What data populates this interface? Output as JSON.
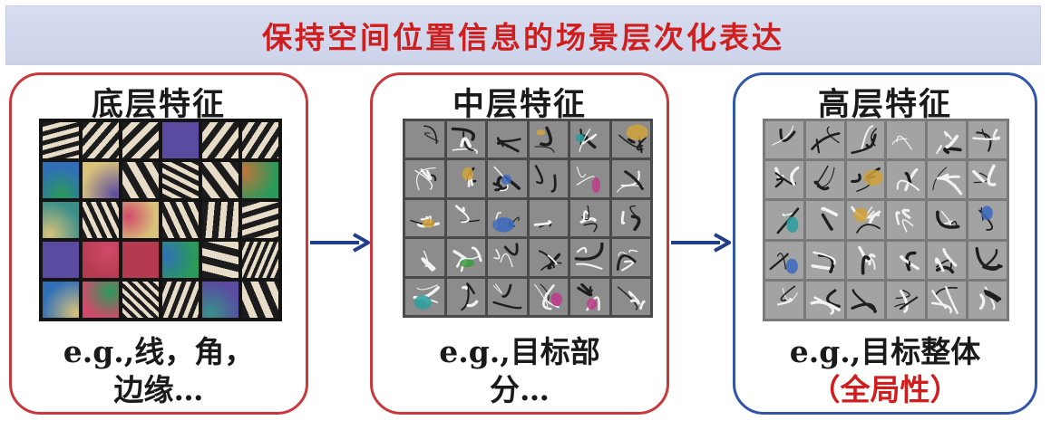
{
  "banner": {
    "title": "保持空间位置信息的场景层次化表达"
  },
  "panels": {
    "low": {
      "title": "底层特征",
      "caption_line1": "e.g.,线，角，",
      "caption_line2": "边缘…"
    },
    "mid": {
      "title": "中层特征",
      "caption_line1": "e.g.,目标部",
      "caption_line2": "分…"
    },
    "high": {
      "title": "高层特征",
      "caption_line1": "e.g.,目标整体",
      "caption_line2": "（全局性）"
    }
  },
  "colors": {
    "banner_bg": "#d0d6ec",
    "banner_text": "#d01e1e",
    "panel_red_border": "#c8383c",
    "panel_blue_border": "#2f56a8",
    "arrow": "#1f3f8a"
  },
  "icons": {
    "arrow_low_to_mid": "right-arrow-icon",
    "arrow_mid_to_high": "right-arrow-icon"
  }
}
